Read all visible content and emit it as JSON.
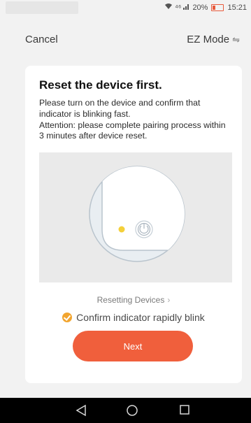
{
  "status": {
    "signal": "⁴⁶",
    "battery": "20%",
    "time": "15:21"
  },
  "header": {
    "cancel_label": "Cancel",
    "mode_label": "EZ Mode",
    "mode_icon": "swap-arrows-icon"
  },
  "card": {
    "title": "Reset the device first.",
    "description_1": "Please turn on the device and confirm that indicator is blinking fast.",
    "description_2": "Attention: please complete pairing process within 3 minutes after device reset.",
    "resetting_link": "Resetting Devices",
    "confirm_label": "Confirm indicator rapidly blink",
    "next_label": "Next"
  },
  "colors": {
    "accent": "#f05f3c",
    "check": "#f2a52f",
    "indicator": "#f4d03a"
  }
}
